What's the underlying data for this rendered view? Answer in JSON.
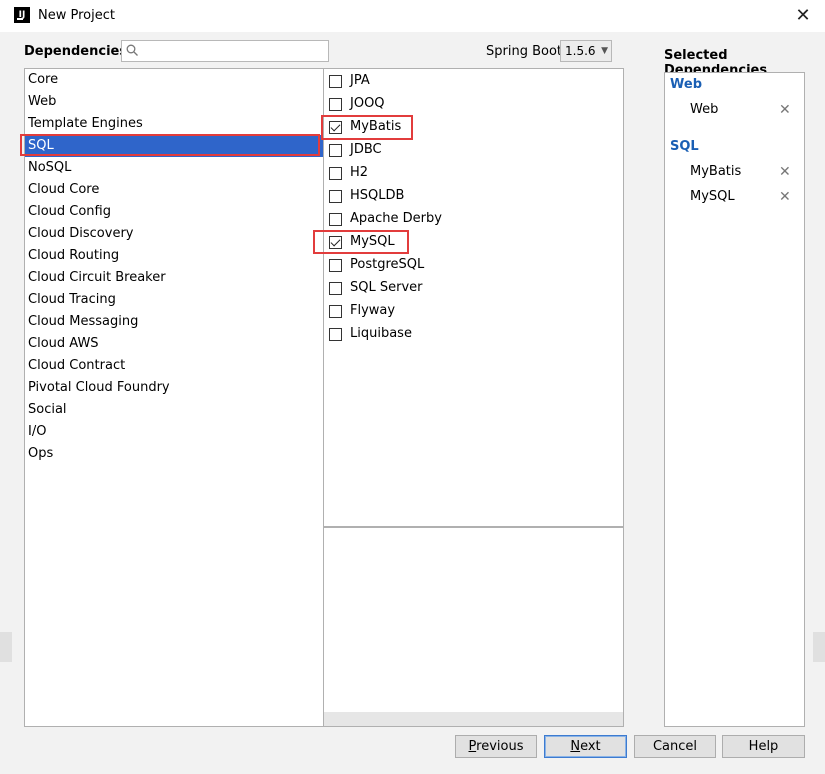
{
  "window": {
    "title": "New Project",
    "close_glyph": "✕"
  },
  "header": {
    "dependencies_label": "Dependencies",
    "search_value": "",
    "spring_boot_label": "Spring Boot",
    "spring_boot_version": "1.5.6",
    "selected_dependencies_label": "Selected Dependencies"
  },
  "categories": [
    "Core",
    "Web",
    "Template Engines",
    "SQL",
    "NoSQL",
    "Cloud Core",
    "Cloud Config",
    "Cloud Discovery",
    "Cloud Routing",
    "Cloud Circuit Breaker",
    "Cloud Tracing",
    "Cloud Messaging",
    "Cloud AWS",
    "Cloud Contract",
    "Pivotal Cloud Foundry",
    "Social",
    "I/O",
    "Ops"
  ],
  "selected_category": "SQL",
  "dependencies": [
    {
      "label": "JPA",
      "checked": false
    },
    {
      "label": "JOOQ",
      "checked": false
    },
    {
      "label": "MyBatis",
      "checked": true
    },
    {
      "label": "JDBC",
      "checked": false
    },
    {
      "label": "H2",
      "checked": false
    },
    {
      "label": "HSQLDB",
      "checked": false
    },
    {
      "label": "Apache Derby",
      "checked": false
    },
    {
      "label": "MySQL",
      "checked": true
    },
    {
      "label": "PostgreSQL",
      "checked": false
    },
    {
      "label": "SQL Server",
      "checked": false
    },
    {
      "label": "Flyway",
      "checked": false
    },
    {
      "label": "Liquibase",
      "checked": false
    }
  ],
  "selected": {
    "groups": [
      {
        "name": "Web",
        "items": [
          "Web"
        ]
      },
      {
        "name": "SQL",
        "items": [
          "MyBatis",
          "MySQL"
        ]
      }
    ],
    "remove_glyph": "✕"
  },
  "buttons": {
    "previous": {
      "mnemonic": "P",
      "rest": "revious"
    },
    "next": {
      "mnemonic": "N",
      "rest": "ext"
    },
    "cancel": "Cancel",
    "help": "Help"
  },
  "colors": {
    "selection": "#2f65ca",
    "group_header": "#1a5fb4",
    "highlight_box": "#e23c3c"
  }
}
